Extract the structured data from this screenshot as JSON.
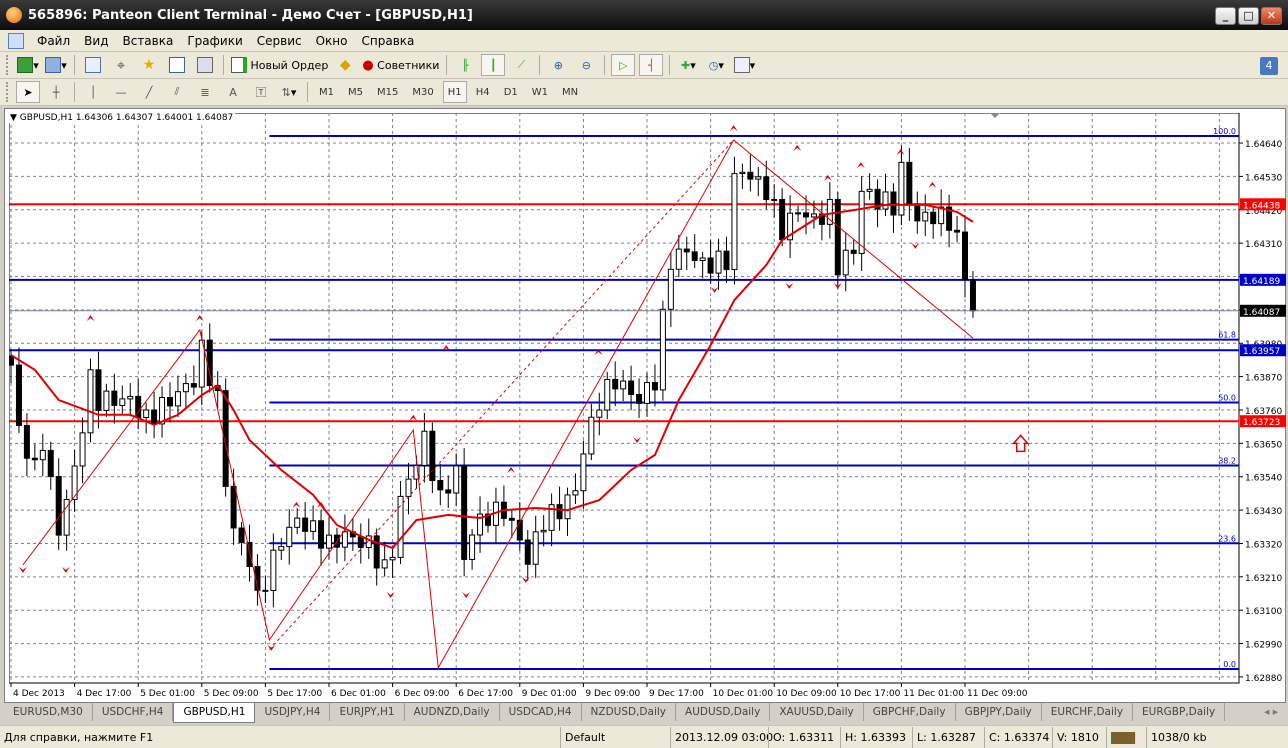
{
  "window": {
    "title": "565896: Panteon Client Terminal - Демо Счет - [GBPUSD,H1]"
  },
  "menu": [
    "Файл",
    "Вид",
    "Вставка",
    "Графики",
    "Сервис",
    "Окно",
    "Справка"
  ],
  "toolbar": {
    "new_order": "Новый Ордер",
    "experts": "Советники"
  },
  "timeframes": [
    "M1",
    "M5",
    "M15",
    "M30",
    "H1",
    "H4",
    "D1",
    "W1",
    "MN"
  ],
  "active_timeframe": "H1",
  "side_badge": "4",
  "chart_header": "GBPUSD,H1  1.64306 1.64307 1.64001 1.64087",
  "tabs": [
    "EURUSD,M30",
    "USDCHF,H4",
    "GBPUSD,H1",
    "USDJPY,H4",
    "EURJPY,H1",
    "AUDNZD,Daily",
    "USDCAD,H4",
    "NZDUSD,Daily",
    "AUDUSD,Daily",
    "XAUUSD,Daily",
    "GBPCHF,Daily",
    "GBPJPY,Daily",
    "EURCHF,Daily",
    "EURGBP,Daily"
  ],
  "active_tab": "GBPUSD,H1",
  "status": {
    "help": "Для справки, нажмите F1",
    "profile": "Default",
    "datetime": "2013.12.09 03:00",
    "open": "O: 1.63311",
    "high": "H: 1.63393",
    "low": "L: 1.63287",
    "close": "C: 1.63374",
    "volume": "V: 1810",
    "traffic": "1038/0 kb"
  },
  "colors": {
    "candle_up": "#ffffff",
    "candle_down": "#000000",
    "ma": "#e00000",
    "zigzag": "#e00000",
    "fib": "#0000c0",
    "grid": "#7a8290"
  },
  "chart_data": {
    "type": "candlestick",
    "symbol": "GBPUSD",
    "timeframe": "H1",
    "ylim": [
      1.6286,
      1.64739
    ],
    "bars_total": 122,
    "y_ticks": [
      1.6464,
      1.6453,
      1.6442,
      1.6431,
      1.642,
      1.6409,
      1.6398,
      1.6387,
      1.6376,
      1.6365,
      1.6354,
      1.6343,
      1.6332,
      1.6321,
      1.631,
      1.6299,
      1.6288
    ],
    "y_tick_labels": [
      "1.64640",
      "1.64530",
      "1.64420",
      "1.64310",
      "",
      "",
      "1.63980",
      "1.63870",
      "1.63760",
      "1.63650",
      "1.63540",
      "1.63430",
      "1.63320",
      "1.63210",
      "1.63100",
      "1.62990",
      "1.62880"
    ],
    "x_labels": [
      "4 Dec 2013",
      "4 Dec 17:00",
      "5 Dec 01:00",
      "5 Dec 09:00",
      "5 Dec 17:00",
      "6 Dec 01:00",
      "6 Dec 09:00",
      "6 Dec 17:00",
      "9 Dec 01:00",
      "9 Dec 09:00",
      "9 Dec 17:00",
      "10 Dec 01:00",
      "10 Dec 09:00",
      "10 Dec 17:00",
      "11 Dec 01:00",
      "11 Dec 09:00"
    ],
    "bars_per_label": 8,
    "close_path": [
      [
        0,
        1.63908
      ],
      [
        1,
        1.63694
      ],
      [
        3,
        1.63562
      ],
      [
        4,
        1.63661
      ],
      [
        6,
        1.63364
      ],
      [
        7,
        1.63463
      ],
      [
        8,
        1.63562
      ],
      [
        10,
        1.63859
      ],
      [
        11,
        1.63793
      ],
      [
        15,
        1.63793
      ],
      [
        17,
        1.63727
      ],
      [
        20,
        1.63793
      ],
      [
        23,
        1.63859
      ],
      [
        24,
        1.63958
      ],
      [
        26,
        1.63793
      ],
      [
        27,
        1.63529
      ],
      [
        28,
        1.63364
      ],
      [
        30,
        1.63266
      ],
      [
        31,
        1.63134
      ],
      [
        33,
        1.63266
      ],
      [
        34,
        1.63332
      ],
      [
        36,
        1.63397
      ],
      [
        38,
        1.63364
      ],
      [
        40,
        1.63315
      ],
      [
        42,
        1.63348
      ],
      [
        45,
        1.63315
      ],
      [
        47,
        1.63233
      ],
      [
        48,
        1.63299
      ],
      [
        49,
        1.63463
      ],
      [
        51,
        1.63595
      ],
      [
        52,
        1.63661
      ],
      [
        53,
        1.63562
      ],
      [
        54,
        1.63463
      ],
      [
        56,
        1.63562
      ],
      [
        57,
        1.63266
      ],
      [
        58,
        1.63364
      ],
      [
        60,
        1.63414
      ],
      [
        62,
        1.6343
      ],
      [
        64,
        1.63332
      ],
      [
        65,
        1.63266
      ],
      [
        67,
        1.63397
      ],
      [
        69,
        1.6343
      ],
      [
        71,
        1.63496
      ],
      [
        72,
        1.63628
      ],
      [
        74,
        1.63793
      ],
      [
        76,
        1.63859
      ],
      [
        79,
        1.63793
      ],
      [
        81,
        1.63859
      ],
      [
        82,
        1.64057
      ],
      [
        83,
        1.64254
      ],
      [
        85,
        1.64287
      ],
      [
        87,
        1.64238
      ],
      [
        90,
        1.64254
      ],
      [
        91,
        1.64518
      ],
      [
        92,
        1.64551
      ],
      [
        95,
        1.64485
      ],
      [
        97,
        1.64353
      ],
      [
        99,
        1.64419
      ],
      [
        101,
        1.64386
      ],
      [
        103,
        1.64419
      ],
      [
        104,
        1.64238
      ],
      [
        106,
        1.64287
      ],
      [
        107,
        1.64485
      ],
      [
        109,
        1.64452
      ],
      [
        111,
        1.64436
      ],
      [
        112,
        1.64551
      ],
      [
        113,
        1.64452
      ],
      [
        114,
        1.64386
      ],
      [
        116,
        1.64403
      ],
      [
        118,
        1.64386
      ],
      [
        119,
        1.6432
      ],
      [
        121,
        1.64087
      ]
    ],
    "moving_average": [
      [
        0,
        1.63941
      ],
      [
        3,
        1.63892
      ],
      [
        6,
        1.63793
      ],
      [
        11,
        1.63744
      ],
      [
        15,
        1.63744
      ],
      [
        18,
        1.63711
      ],
      [
        21,
        1.63744
      ],
      [
        24,
        1.63809
      ],
      [
        26,
        1.63842
      ],
      [
        28,
        1.6376
      ],
      [
        30,
        1.63661
      ],
      [
        34,
        1.63562
      ],
      [
        38,
        1.6348
      ],
      [
        41,
        1.63381
      ],
      [
        45,
        1.63332
      ],
      [
        48,
        1.63305
      ],
      [
        51,
        1.63397
      ],
      [
        55,
        1.63414
      ],
      [
        59,
        1.63404
      ],
      [
        62,
        1.6343
      ],
      [
        66,
        1.63437
      ],
      [
        70,
        1.6343
      ],
      [
        74,
        1.63463
      ],
      [
        78,
        1.63562
      ],
      [
        81,
        1.63612
      ],
      [
        84,
        1.63793
      ],
      [
        88,
        1.63974
      ],
      [
        91,
        1.64123
      ],
      [
        95,
        1.64238
      ],
      [
        97,
        1.6432
      ],
      [
        100,
        1.6437
      ],
      [
        102,
        1.64403
      ],
      [
        106,
        1.64419
      ],
      [
        110,
        1.64436
      ],
      [
        115,
        1.64436
      ],
      [
        119,
        1.64413
      ],
      [
        121,
        1.6438
      ]
    ],
    "zigzag": [
      [
        1.5,
        1.63249
      ],
      [
        23.75,
        1.64024
      ],
      [
        32.5,
        1.63002
      ],
      [
        50.6,
        1.63694
      ],
      [
        53.75,
        1.6291
      ],
      [
        90.9,
        1.6465
      ],
      [
        121,
        1.63997
      ]
    ],
    "zigzag_dashed": [
      [
        32.5,
        1.6297
      ],
      [
        90.9,
        1.6465
      ]
    ],
    "fractals_up": [
      [
        10,
        1.64063
      ],
      [
        23.75,
        1.64063
      ],
      [
        35.9,
        1.63447
      ],
      [
        39,
        1.63447
      ],
      [
        50.6,
        1.63734
      ],
      [
        54.75,
        1.63964
      ],
      [
        62.9,
        1.63562
      ],
      [
        73.9,
        1.63951
      ],
      [
        90.9,
        1.64689
      ],
      [
        98.9,
        1.64624
      ],
      [
        102.75,
        1.64525
      ],
      [
        106.9,
        1.64567
      ],
      [
        111.9,
        1.6461
      ],
      [
        115.9,
        1.64502
      ]
    ],
    "fractals_down": [
      [
        1.5,
        1.63233
      ],
      [
        6.9,
        1.63233
      ],
      [
        32.75,
        1.62976
      ],
      [
        47.75,
        1.6315
      ],
      [
        57.25,
        1.6315
      ],
      [
        64.75,
        1.632
      ],
      [
        78.75,
        1.63661
      ],
      [
        88.5,
        1.64156
      ],
      [
        97.9,
        1.64169
      ],
      [
        104,
        1.64169
      ],
      [
        113.75,
        1.64301
      ]
    ],
    "fibonacci": {
      "start_bar": 32.5,
      "low": 1.62906,
      "high": 1.64663,
      "levels": [
        0.0,
        23.6,
        38.2,
        50.0,
        61.8,
        100.0
      ],
      "labels": [
        "0.0",
        "23.6",
        "38.2",
        "50.0",
        "61.8",
        "100.0"
      ]
    },
    "hlines": [
      {
        "price": 1.64438,
        "label": "1.64438",
        "color": "#ff0000"
      },
      {
        "price": 1.64189,
        "label": "1.64189",
        "color": "#0000c8"
      },
      {
        "price": 1.63957,
        "label": "1.63957",
        "color": "#0000c8"
      },
      {
        "price": 1.63723,
        "label": "1.63723",
        "color": "#ff0000"
      }
    ],
    "bid": {
      "price": 1.64087,
      "label": "1.64087"
    },
    "arrow_up_marker": {
      "bar": 127,
      "price": 1.6365
    }
  }
}
